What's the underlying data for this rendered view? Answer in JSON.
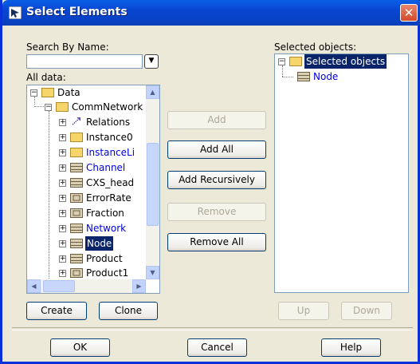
{
  "window": {
    "title": "Select Elements",
    "close": "✕"
  },
  "search": {
    "label": "Search By Name:",
    "value": "",
    "dropdown_icon": "▼"
  },
  "all_data": {
    "label": "All data:",
    "tree": [
      {
        "label": "Data",
        "icon": "package-icon",
        "expander": "−"
      },
      {
        "label": "CommNetwork",
        "icon": "folder-icon",
        "expander": "−"
      },
      {
        "label": "Relations",
        "icon": "relation-icon",
        "expander": "+"
      },
      {
        "label": "Instance0",
        "icon": "folder-icon",
        "expander": "+"
      },
      {
        "label": "InstanceLi",
        "icon": "folder-icon",
        "expander": "+",
        "color": "blue"
      },
      {
        "label": "Channel",
        "icon": "block-icon",
        "expander": "+",
        "color": "blue"
      },
      {
        "label": "CXS_head",
        "icon": "block-icon",
        "expander": "+"
      },
      {
        "label": "ErrorRate",
        "icon": "valuetype-icon",
        "expander": "+"
      },
      {
        "label": "Fraction",
        "icon": "valuetype-icon",
        "expander": "+"
      },
      {
        "label": "Network",
        "icon": "block-icon",
        "expander": "+",
        "color": "blue"
      },
      {
        "label": "Node",
        "icon": "block-icon",
        "expander": "+",
        "selected": true
      },
      {
        "label": "Product",
        "icon": "block-icon",
        "expander": "+"
      },
      {
        "label": "Product1",
        "icon": "valuetype-icon",
        "expander": "+"
      }
    ]
  },
  "middle_buttons": {
    "add": "Add",
    "add_all": "Add All",
    "add_recursively": "Add Recursively",
    "remove": "Remove",
    "remove_all": "Remove All"
  },
  "selected": {
    "label": "Selected objects:",
    "tree": [
      {
        "label": "Selected objects",
        "icon": "folder-icon",
        "expander": "−",
        "selected": true
      },
      {
        "label": "Node",
        "icon": "block-icon",
        "color": "blue"
      }
    ]
  },
  "bottom_left_buttons": {
    "create": "Create",
    "clone": "Clone"
  },
  "order_buttons": {
    "up": "Up",
    "down": "Down"
  },
  "footer": {
    "ok": "OK",
    "cancel": "Cancel",
    "help": "Help"
  },
  "colors": {
    "titlebar": "#0846d2",
    "selection": "#0a246a",
    "link_blue": "#0000e0",
    "dialog_bg": "#ece9d8"
  }
}
